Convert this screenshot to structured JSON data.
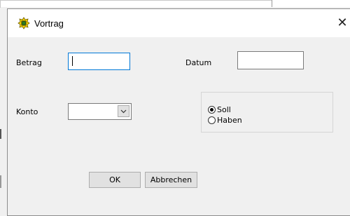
{
  "window": {
    "title": "Vortrag",
    "close_glyph": "✕",
    "app_icon": "yellow-gear-icon"
  },
  "form": {
    "betrag_label": "Betrag",
    "betrag_value": "",
    "datum_label": "Datum",
    "datum_value": "",
    "konto_label": "Konto",
    "konto_value": ""
  },
  "radio_group": {
    "options": [
      {
        "label": "Soll",
        "checked": true
      },
      {
        "label": "Haben",
        "checked": false
      }
    ]
  },
  "buttons": {
    "ok_label": "OK",
    "cancel_label": "Abbrechen"
  },
  "colors": {
    "focus_border": "#0078d7",
    "icon_yellow": "#f5d400"
  }
}
